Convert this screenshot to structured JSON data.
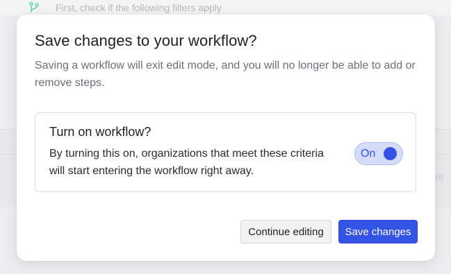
{
  "background": {
    "filter_text": "First, check if the following filters apply",
    "right_text": "nt",
    "branch_icon": "git-branch-icon"
  },
  "dialog": {
    "title": "Save changes to your workflow?",
    "description": "Saving a workflow will exit edit mode, and you will no longer be able to add or remove steps.",
    "option": {
      "title": "Turn on workflow?",
      "description": "By turning this on, organizations that meet these criteria will start entering the workflow right away.",
      "toggle_label": "On",
      "toggle_state": true
    },
    "buttons": {
      "continue_label": "Continue editing",
      "save_label": "Save changes"
    }
  },
  "colors": {
    "primary": "#3253e4",
    "toggle_bg": "#d4dcf9",
    "overlay": "#ededef"
  }
}
